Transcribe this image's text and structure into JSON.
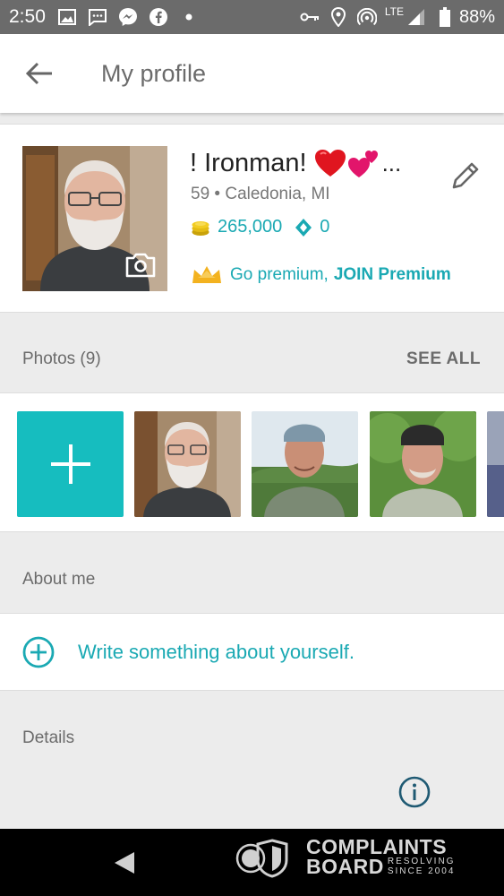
{
  "status_bar": {
    "time": "2:50",
    "left_icons": [
      "image-icon",
      "message-icon",
      "messenger-icon",
      "facebook-icon",
      "dot-icon"
    ],
    "right_icons": [
      "vpn-key-icon",
      "location-icon",
      "hotspot-icon",
      "lte-signal-icon",
      "battery-icon"
    ],
    "network": "LTE",
    "battery": "88%"
  },
  "app_bar": {
    "title": "My profile"
  },
  "profile": {
    "name": "! Ironman!",
    "ellipsis": "...",
    "age_location": "59 • Caledonia, MI",
    "coins": "265,000",
    "gems": "0",
    "premium_prefix": "Go premium,",
    "premium_cta": "JOIN Premium"
  },
  "photos": {
    "header": "Photos (9)",
    "see_all": "SEE ALL"
  },
  "about": {
    "header": "About me",
    "prompt": "Write something about yourself."
  },
  "details": {
    "header": "Details"
  },
  "watermark": {
    "line1": "COMPLAINTS",
    "line2": "BOARD",
    "tag1": "RESOLVING",
    "tag2": "SINCE 2004"
  },
  "colors": {
    "accent": "#1aa9b3",
    "add_tile": "#16bdbf",
    "status_bar": "#6b6b6b",
    "background": "#ececec"
  }
}
